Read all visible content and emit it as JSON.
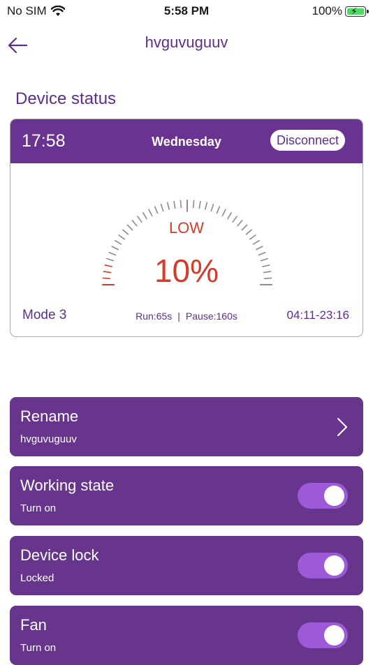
{
  "status_bar": {
    "carrier": "No SIM",
    "time": "5:58 PM",
    "battery": "100%"
  },
  "nav": {
    "title": "hvguvuguuv"
  },
  "section_title": "Device status",
  "device_card": {
    "time": "17:58",
    "day": "Wednesday",
    "disconnect_label": "Disconnect",
    "level_label": "LOW",
    "percent_label": "10%",
    "percent_value": 10,
    "mode": "Mode 3",
    "run": "Run:65s",
    "separator": "|",
    "pause": "Pause:160s",
    "time_range": "04:11-23:16"
  },
  "settings": {
    "rename": {
      "title": "Rename",
      "value": "hvguvuguuv"
    },
    "working_state": {
      "title": "Working state",
      "value": "Turn on",
      "on": true
    },
    "device_lock": {
      "title": "Device lock",
      "value": "Locked",
      "on": true
    },
    "fan": {
      "title": "Fan",
      "value": "Turn on",
      "on": true
    }
  },
  "colors": {
    "brand_purple": "#6a3391",
    "row_purple": "#67368c",
    "toggle_on": "#9d5ad8",
    "alert_red": "#d63a2a"
  }
}
